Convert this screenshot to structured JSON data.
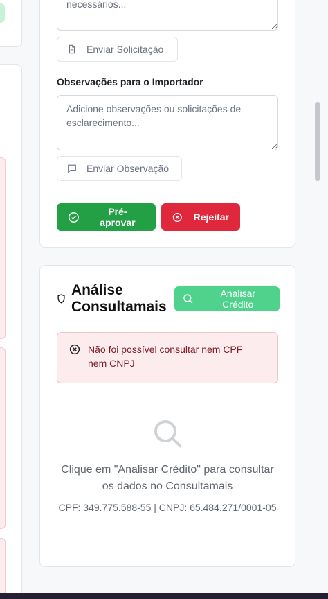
{
  "document_request": {
    "textarea_value": "necessários...",
    "send_button": "Enviar Solicitação"
  },
  "observations": {
    "label": "Observações para o Importador",
    "placeholder": "Adicione observações ou solicitações de esclarecimento...",
    "send_button": "Enviar Observação"
  },
  "actions": {
    "approve": "Pré-aprovar",
    "reject": "Rejeitar"
  },
  "credit_analysis": {
    "title": "Análise Consultamais",
    "analyze_button": "Analisar Crédito",
    "error": "Não foi possível consultar nem CPF nem CNPJ",
    "empty_message": "Clique em \"Analisar Crédito\" para consultar os dados no Consultamais",
    "identifiers": "CPF: 349.775.588-55 | CNPJ: 65.484.271/0001-05"
  },
  "icons": {
    "file": "file-icon",
    "message": "message-icon",
    "check": "check-circle-icon",
    "reject": "x-circle-icon",
    "shield": "shield-icon",
    "search": "search-icon",
    "error": "x-circle-icon",
    "empty": "search-icon"
  },
  "colors": {
    "approve": "#23a045",
    "reject": "#e0283c",
    "analyze": "#4fd28c",
    "alert_bg": "#fdecee",
    "alert_text": "#7a1a24"
  }
}
